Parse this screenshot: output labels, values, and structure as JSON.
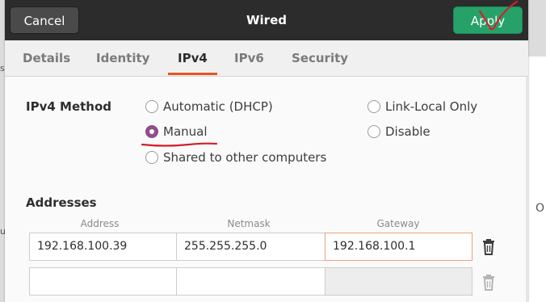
{
  "dialog": {
    "title": "Wired",
    "cancel_label": "Cancel",
    "apply_label": "Apply"
  },
  "tabs": [
    {
      "label": "Details"
    },
    {
      "label": "Identity"
    },
    {
      "label": "IPv4"
    },
    {
      "label": "IPv6"
    },
    {
      "label": "Security"
    }
  ],
  "active_tab": "IPv4",
  "ipv4": {
    "method_label": "IPv4 Method",
    "options": {
      "automatic": "Automatic (DHCP)",
      "link_local": "Link-Local Only",
      "manual": "Manual",
      "disable": "Disable",
      "shared": "Shared to other computers"
    },
    "selected": "Manual"
  },
  "addresses": {
    "label": "Addresses",
    "columns": [
      "Address",
      "Netmask",
      "Gateway"
    ],
    "rows": [
      {
        "address": "192.168.100.39",
        "netmask": "255.255.255.0",
        "gateway": "192.168.100.1"
      },
      {
        "address": "",
        "netmask": "",
        "gateway": ""
      }
    ]
  },
  "background": {
    "right_peek_text": "O",
    "left_peek_top": "s",
    "left_peek_bottom": "u"
  },
  "colors": {
    "apply_green": "#26a269",
    "tab_accent": "#e95420",
    "radio_selected": "#924d8b",
    "annotation_red": "#d21f2a"
  }
}
